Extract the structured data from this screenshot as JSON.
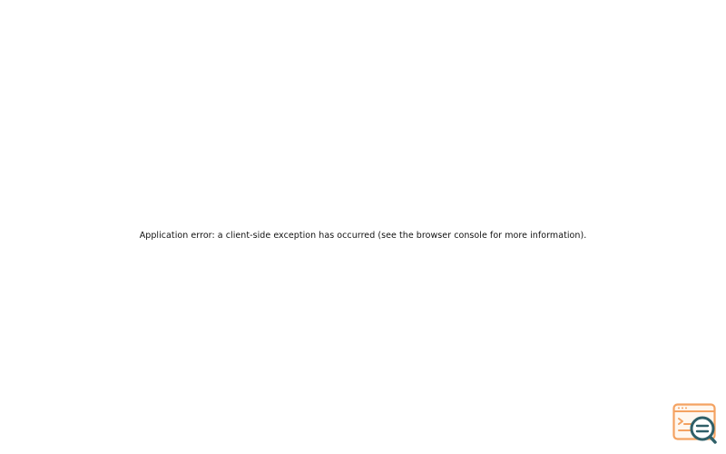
{
  "error": {
    "message": "Application error: a client-side exception has occurred (see the browser console for more information)."
  },
  "debug_tool": {
    "icon": "console-search-icon",
    "colors": {
      "window": "#f4a261",
      "window_fill": "#fff7ef",
      "lens": "#2f5f68",
      "lens_fill": "#ffffff"
    }
  }
}
